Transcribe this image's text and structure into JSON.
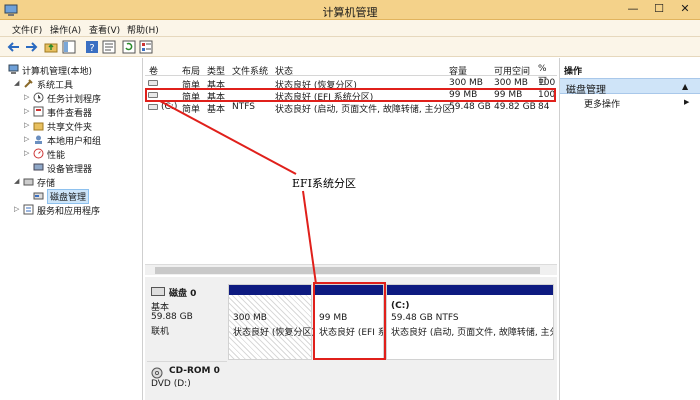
{
  "window": {
    "title": "计算机管理",
    "min": "—",
    "max": "☐",
    "close": "✕"
  },
  "menu": [
    "文件(F)",
    "操作(A)",
    "查看(V)",
    "帮助(H)"
  ],
  "tree": {
    "root": "计算机管理(本地)",
    "system_tools": "系统工具",
    "task_scheduler": "任务计划程序",
    "event_viewer": "事件查看器",
    "shared_folders": "共享文件夹",
    "local_users": "本地用户和组",
    "performance": "性能",
    "device_manager": "设备管理器",
    "storage": "存储",
    "disk_management": "磁盘管理",
    "services_apps": "服务和应用程序"
  },
  "table": {
    "headers": [
      "卷",
      "布局",
      "类型",
      "文件系统",
      "状态",
      "容量",
      "可用空间",
      "% 可"
    ],
    "rows": [
      {
        "vol": "",
        "layout": "简单",
        "type": "基本",
        "fs": "",
        "status": "状态良好 (恢复分区)",
        "cap": "300 MB",
        "free": "300 MB",
        "pct": "100"
      },
      {
        "vol": "",
        "layout": "简单",
        "type": "基本",
        "fs": "",
        "status": "状态良好 (EFI 系统分区)",
        "cap": "99 MB",
        "free": "99 MB",
        "pct": "100"
      },
      {
        "vol": "(C:)",
        "layout": "简单",
        "type": "基本",
        "fs": "NTFS",
        "status": "状态良好 (启动, 页面文件, 故障转储, 主分区)",
        "cap": "59.48 GB",
        "free": "49.82 GB",
        "pct": "84"
      }
    ]
  },
  "disk0": {
    "name": "磁盘 0",
    "type": "基本",
    "size": "59.88 GB",
    "state": "联机"
  },
  "partitions": [
    {
      "line1": "",
      "line2": "300 MB",
      "line3": "状态良好 (恢复分区)"
    },
    {
      "line1": "",
      "line2": "99 MB",
      "line3": "状态良好 (EFI 系统"
    },
    {
      "line1": "(C:)",
      "line2": "59.48 GB NTFS",
      "line3": "状态良好 (启动, 页面文件, 故障转储, 主分区"
    }
  ],
  "cdrom": {
    "name": "CD-ROM 0",
    "drive": "DVD (D:)"
  },
  "actions": {
    "header": "操作",
    "section": "磁盘管理",
    "more": "更多操作",
    "section_arrow": "▲",
    "more_arrow": "▶"
  },
  "annotation": "EFI系统分区",
  "colors": {
    "highlight": "#e0201b",
    "partition_bar": "#0d1a80",
    "titlebar": "#f4d28a"
  }
}
